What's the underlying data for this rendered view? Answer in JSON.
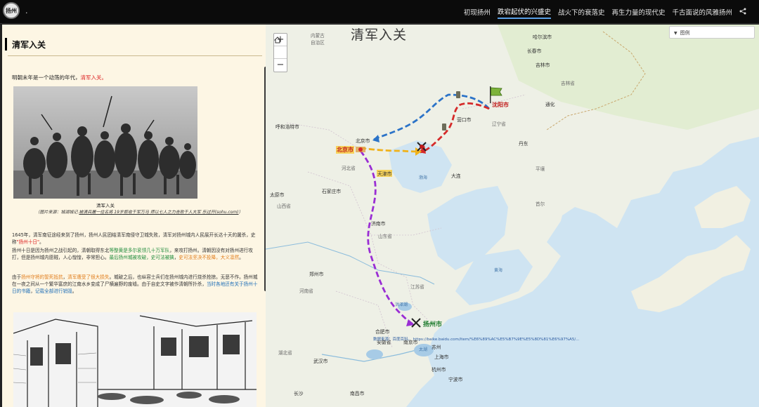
{
  "app": {
    "logo_text": "扬州",
    "title": "."
  },
  "nav": {
    "items": [
      {
        "label": "初现扬州"
      },
      {
        "label": "跌宕起伏的兴盛史"
      },
      {
        "label": "战火下的衰落史"
      },
      {
        "label": "再生力量的现代史"
      },
      {
        "label": "千古面说的风雅扬州"
      }
    ],
    "active_index": 1,
    "share_icon": "share-icon"
  },
  "panel": {
    "title": "清军入关",
    "intro_a": "明朝末年是一个动荡的年代，",
    "intro_b": "清军入关。",
    "photo1_caption": "清军入关",
    "photo1_source_a": "（图片来源：城湖城记.",
    "photo1_source_link": "被清兵屠一位名将 19岁拒收千军万马 师以七人之力击败千人大军 乐过开(sohu.com)",
    "photo1_source_b": "）",
    "para1_a": "1645年，清军南征途经来到了扬州，扬州人民团结清军南侵守卫城失败，清军对扬州城内人民展开长达十天的屠杀，史称",
    "para1_b": "\"扬州十日\"",
    "para1_c": "。",
    "para2_a": "扬州十日是因为扬州之战引起的，清朝取得东北",
    "para2_b": "等整黄是多尔衮领几十万军队",
    "para2_c": "，来攻打扬州。清朝因没有对扬州进行攻打，但是扬州城内愿贼，人心惶惶，非常担心。",
    "para2_d": "最后扬州城被攻破，史可法被擒",
    "para2_e": "，",
    "para2_f": "史可法坚决不投降，大义凛然",
    "para2_g": "。",
    "para3_a": "由于",
    "para3_b": "扬州守将的誓死抵抗",
    "para3_c": "，",
    "para3_d": "清军遭受了很大损失",
    "para3_e": "。城破之后，也纵容士兵们在扬州城内进行烧杀抢掠。无恶不作。扬州城在一夜之间从一个繁华富庶的江南水乡变成了尸横遍野的废墟。由于自史文字被作清朝所扑杀，",
    "para3_f": "当时各地还有关于扬州十日的书籍",
    "para3_g": "，",
    "para3_h": "记载全部进行销毁",
    "para3_i": "。"
  },
  "map": {
    "title": "清军入关",
    "zoom_in": "+",
    "home_icon": "home-icon",
    "zoom_out": "−",
    "legend_label": "图例",
    "labels": {
      "inner_mongolia_a": "内蒙古",
      "inner_mongolia_b": "自治区",
      "changchun": "长春市",
      "shenyang": "沈阳市",
      "liaoning": "辽宁省",
      "beijing_city": "北京市",
      "beijing_prov": "北京市",
      "tianjin": "天津市",
      "hebei": "河北省",
      "hohhot": "呼和浩特市",
      "taiyuan": "太原市",
      "shanxi": "山西省",
      "shijiazhuang": "石家庄市",
      "jinan": "济南市",
      "shandong": "山东省",
      "zhengzhou": "郑州市",
      "henan": "河南省",
      "jiangsu": "江苏省",
      "hefei": "合肥市",
      "anhui": "安徽省",
      "nanjing": "南京市",
      "shanghai": "上海市",
      "hangzhou": "杭州市",
      "wuhan": "武汉市",
      "hubei": "湖北省",
      "yangzhou": "扬州市",
      "bohai": "渤海",
      "huanghai": "黄海",
      "jilin": "吉林省",
      "harbin": "哈尔滨市",
      "pyongyang": "平壤",
      "seoul": "首尔",
      "taihu": "太湖",
      "hongzehu": "洪泽湖",
      "dalian": "大连",
      "ningbo": "宁波市",
      "huaihe": "淮河",
      "changsha": "长沙",
      "nanchang": "南昌市",
      "suzhou": "苏州",
      "yingkou": "营口市",
      "dandong": "丹东",
      "yellow_sea_n": "黄海",
      "jilin_city": "吉林市",
      "tonghua": "通化"
    },
    "source_text": "数据来源：百度百科。 https://baike.baidu.com/item/%E6%89%AC%E5%B7%9E%E5%8D%81%E6%97%A5/..."
  }
}
